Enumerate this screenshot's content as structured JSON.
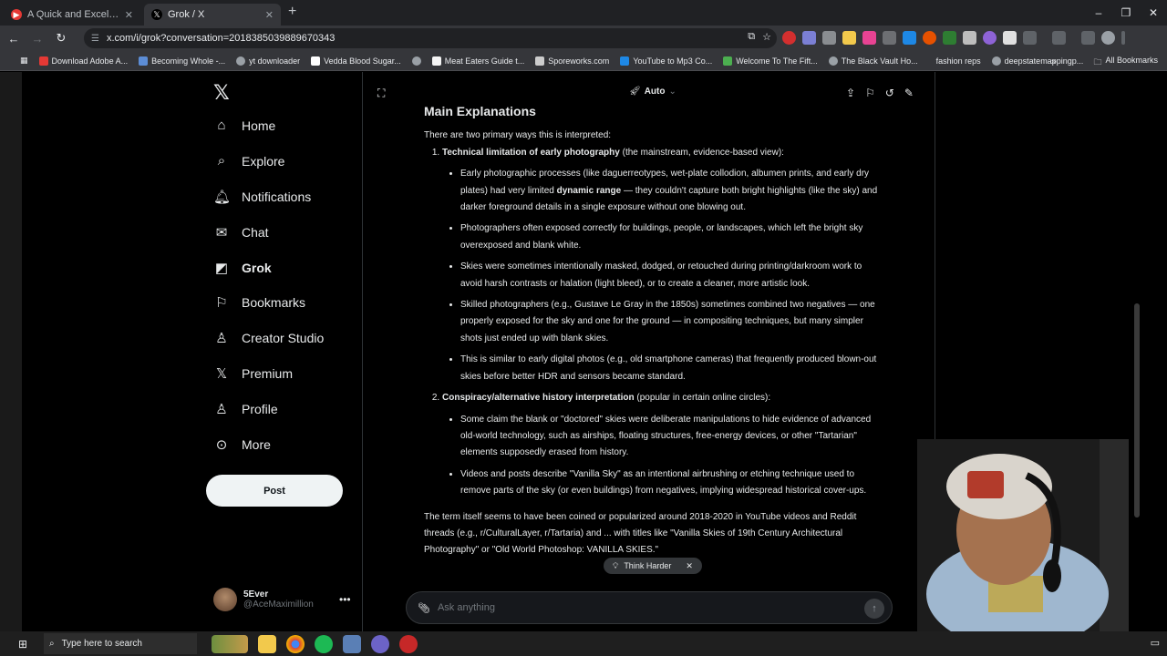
{
  "browser": {
    "tabs": [
      {
        "title": "A Quick and Excellent Observati",
        "active": false,
        "favicon_color": "#e53935"
      },
      {
        "title": "Grok / X",
        "active": true,
        "favicon_color": "#000000"
      }
    ],
    "new_tab": "+",
    "window_controls": {
      "minimize": "–",
      "restore": "❐",
      "close": "✕"
    },
    "url": "x.com/i/grok?conversation=2018385039889670343",
    "bookmarks": [
      {
        "label": "Download Adobe A...",
        "color": "#e53935"
      },
      {
        "label": "Becoming Whole -...",
        "color": "#5c8dd6"
      },
      {
        "label": "yt downloader",
        "color": "#9aa0a6"
      },
      {
        "label": "Vedda Blood Sugar...",
        "color": "#ffffff"
      },
      {
        "label": "",
        "color": "#9aa0a6"
      },
      {
        "label": "Meat Eaters Guide t...",
        "color": "#f5f5f5"
      },
      {
        "label": "Sporeworks.com",
        "color": "#cccccc"
      },
      {
        "label": "YouTube to Mp3 Co...",
        "color": "#1e88e5"
      },
      {
        "label": "Welcome To The Fift...",
        "color": "#4caf50"
      },
      {
        "label": "The Black Vault Ho...",
        "color": "#9aa0a6"
      },
      {
        "label": "fashion reps",
        "color": ""
      },
      {
        "label": "deepstatemappingp...",
        "color": "#9aa0a6"
      }
    ],
    "all_bookmarks": "All Bookmarks"
  },
  "sidebar": {
    "logo": "𝕏",
    "items": [
      {
        "label": "Home",
        "icon": "⌂",
        "active": false
      },
      {
        "label": "Explore",
        "icon": "⌕",
        "active": false
      },
      {
        "label": "Notifications",
        "icon": "🔔",
        "active": false
      },
      {
        "label": "Chat",
        "icon": "✉",
        "active": false
      },
      {
        "label": "Grok",
        "icon": "◩",
        "active": true
      },
      {
        "label": "Bookmarks",
        "icon": "🔖",
        "active": false
      },
      {
        "label": "Creator Studio",
        "icon": "♙",
        "active": false
      },
      {
        "label": "Premium",
        "icon": "𝕏",
        "active": false
      },
      {
        "label": "Profile",
        "icon": "♙",
        "active": false
      },
      {
        "label": "More",
        "icon": "⋯",
        "active": false
      }
    ],
    "post_label": "Post",
    "profile": {
      "name": "5Ever",
      "handle": "@AceMaximillion"
    }
  },
  "header": {
    "mode": "Auto"
  },
  "message": {
    "heading": "Main Explanations",
    "intro": "There are two primary ways this is interpreted:",
    "sections": [
      {
        "title": "Technical limitation of early photography",
        "title_suffix": " (the mainstream, evidence-based view):",
        "bullets": [
          {
            "pre": "Early photographic processes (like daguerreotypes, wet-plate collodion, albumen prints, and early dry plates) had very limited ",
            "bold": "dynamic range",
            "post": " — they couldn't capture both bright highlights (like the sky) and darker foreground details in a single exposure without one blowing out."
          },
          {
            "pre": "Photographers often exposed correctly for buildings, people, or landscapes, which left the bright sky overexposed and blank white.",
            "bold": "",
            "post": ""
          },
          {
            "pre": "Skies were sometimes intentionally masked, dodged, or retouched during printing/darkroom work to avoid harsh contrasts or halation (light bleed), or to create a cleaner, more artistic look.",
            "bold": "",
            "post": ""
          },
          {
            "pre": "Skilled photographers (e.g., Gustave Le Gray in the 1850s) sometimes combined two negatives — one properly exposed for the sky and one for the ground — in compositing techniques, but many simpler shots just ended up with blank skies.",
            "bold": "",
            "post": ""
          },
          {
            "pre": "This is similar to early digital photos (e.g., old smartphone cameras) that frequently produced blown-out skies before better HDR and sensors became standard.",
            "bold": "",
            "post": ""
          }
        ]
      },
      {
        "title": "Conspiracy/alternative history interpretation",
        "title_suffix": " (popular in certain online circles):",
        "bullets": [
          {
            "pre": "Some claim the blank or \"doctored\" skies were deliberate manipulations to hide evidence of advanced old-world technology, such as airships, floating structures, free-energy devices, or other \"Tartarian\" elements supposedly erased from history.",
            "bold": "",
            "post": ""
          },
          {
            "pre": "Videos and posts describe \"Vanilla Sky\" as an intentional airbrushing or etching technique used to remove parts of the sky (or even buildings) from negatives, implying widespread historical cover-ups.",
            "bold": "",
            "post": ""
          }
        ]
      }
    ],
    "footer": "The term itself seems to have been coined or popularized around 2018-2020 in YouTube videos and Reddit threads (e.g., r/CulturalLayer, r/Tartaria) and ... with titles like \"Vanilla Skies of 19th Century Architectural Photography\" or \"Old World Photoshop: VANILLA SKIES.\""
  },
  "composer": {
    "think_harder": "Think Harder",
    "placeholder": "Ask anything"
  },
  "taskbar": {
    "search_placeholder": "Type here to search"
  }
}
